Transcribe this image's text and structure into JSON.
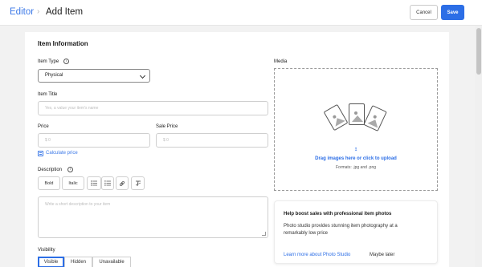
{
  "header": {
    "breadcrumb_parent": "Editor",
    "separator": "›",
    "title": "Add Item",
    "cancel_label": "Cancel",
    "save_label": "Save"
  },
  "form": {
    "section_title": "Item Information",
    "item_type": {
      "label": "Item Type",
      "value": "Physical"
    },
    "item_title": {
      "label": "Item Title",
      "placeholder": "Yes, a value your item's name"
    },
    "price": {
      "label": "Price",
      "placeholder": "$ 0"
    },
    "sale_price": {
      "label": "Sale Price",
      "placeholder": "$ 0"
    },
    "calculate_price": "Calculate price",
    "description": {
      "label": "Description",
      "toolbar": {
        "bold": "Bold",
        "italic": "Italic"
      },
      "placeholder": "Write a short description to your item"
    },
    "visibility": {
      "label": "Visibility",
      "options": [
        "Visible",
        "Hidden",
        "Unavailable"
      ],
      "selected": "Visible"
    }
  },
  "media": {
    "label": "Media",
    "upload_text": "Drag images here or click to upload",
    "formats": "Formats: .jpg and .png"
  },
  "promo": {
    "title": "Help boost sales with professional item photos",
    "body": "Photo studio provides stunning item photography at a remarkably low price",
    "learn_more": "Learn more about Photo Studio",
    "maybe_later": "Maybe later"
  },
  "colors": {
    "accent": "#2c6ee6",
    "link": "#3b78e7",
    "background": "#f2f2f2"
  }
}
